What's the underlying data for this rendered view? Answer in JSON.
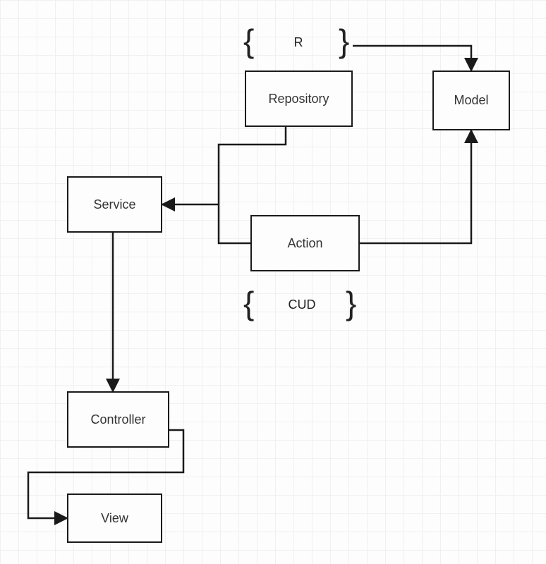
{
  "nodes": {
    "repository": {
      "label": "Repository"
    },
    "model": {
      "label": "Model"
    },
    "service": {
      "label": "Service"
    },
    "action": {
      "label": "Action"
    },
    "controller": {
      "label": "Controller"
    },
    "view": {
      "label": "View"
    }
  },
  "annotations": {
    "r": {
      "label": "R"
    },
    "cud": {
      "label": "CUD"
    }
  },
  "edges": [
    {
      "from": "repository",
      "to": "model",
      "dir": "right"
    },
    {
      "from": "repository",
      "to": "service",
      "dir": "down-left-combine"
    },
    {
      "from": "action",
      "to": "model",
      "dir": "right-up"
    },
    {
      "from": "action",
      "to": "service",
      "dir": "left-combine"
    },
    {
      "from": "service",
      "to": "controller",
      "dir": "down"
    },
    {
      "from": "controller",
      "to": "view",
      "dir": "right-down-left"
    }
  ]
}
